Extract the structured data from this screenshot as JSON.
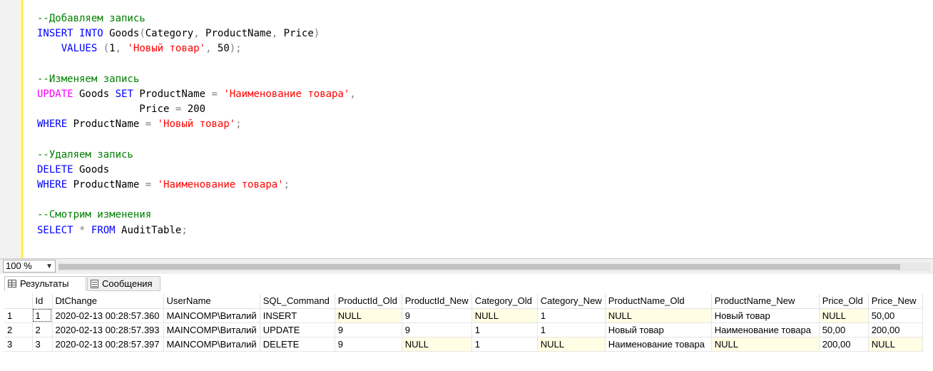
{
  "editor": {
    "lines": [
      [
        {
          "t": "--Добавляем запись",
          "c": "c"
        }
      ],
      [
        {
          "t": "INSERT",
          "c": "k"
        },
        {
          "t": " "
        },
        {
          "t": "INTO",
          "c": "k"
        },
        {
          "t": " Goods"
        },
        {
          "t": "(",
          "c": "g"
        },
        {
          "t": "Category"
        },
        {
          "t": ",",
          "c": "g"
        },
        {
          "t": " ProductName"
        },
        {
          "t": ",",
          "c": "g"
        },
        {
          "t": " Price"
        },
        {
          "t": ")",
          "c": "g"
        }
      ],
      [
        {
          "t": "    "
        },
        {
          "t": "VALUES",
          "c": "k"
        },
        {
          "t": " "
        },
        {
          "t": "(",
          "c": "g"
        },
        {
          "t": "1"
        },
        {
          "t": ",",
          "c": "g"
        },
        {
          "t": " "
        },
        {
          "t": "'Новый товар'",
          "c": "s"
        },
        {
          "t": ",",
          "c": "g"
        },
        {
          "t": " 50"
        },
        {
          "t": ");",
          "c": "g"
        }
      ],
      [],
      [
        {
          "t": "--Изменяем запись",
          "c": "c"
        }
      ],
      [
        {
          "t": "UPDATE",
          "c": "p"
        },
        {
          "t": " Goods "
        },
        {
          "t": "SET",
          "c": "k"
        },
        {
          "t": " ProductName "
        },
        {
          "t": "=",
          "c": "g"
        },
        {
          "t": " "
        },
        {
          "t": "'Наименование товара'",
          "c": "s"
        },
        {
          "t": ",",
          "c": "g"
        }
      ],
      [
        {
          "t": "                 Price "
        },
        {
          "t": "=",
          "c": "g"
        },
        {
          "t": " 200"
        }
      ],
      [
        {
          "t": "WHERE",
          "c": "k"
        },
        {
          "t": " ProductName "
        },
        {
          "t": "=",
          "c": "g"
        },
        {
          "t": " "
        },
        {
          "t": "'Новый товар'",
          "c": "s"
        },
        {
          "t": ";",
          "c": "g"
        }
      ],
      [],
      [
        {
          "t": "--Удаляем запись",
          "c": "c"
        }
      ],
      [
        {
          "t": "DELETE",
          "c": "k"
        },
        {
          "t": " Goods"
        }
      ],
      [
        {
          "t": "WHERE",
          "c": "k"
        },
        {
          "t": " ProductName "
        },
        {
          "t": "=",
          "c": "g"
        },
        {
          "t": " "
        },
        {
          "t": "'Наименование товара'",
          "c": "s"
        },
        {
          "t": ";",
          "c": "g"
        }
      ],
      [],
      [
        {
          "t": "--Смотрим изменения",
          "c": "c"
        }
      ],
      [
        {
          "t": "SELECT",
          "c": "k"
        },
        {
          "t": " "
        },
        {
          "t": "*",
          "c": "g"
        },
        {
          "t": " "
        },
        {
          "t": "FROM",
          "c": "k"
        },
        {
          "t": " AuditTable"
        },
        {
          "t": ";",
          "c": "g"
        }
      ]
    ]
  },
  "zoom": {
    "value": "100 %"
  },
  "tabs": {
    "results": "Результаты",
    "messages": "Сообщения"
  },
  "grid": {
    "columns": [
      "",
      "Id",
      "DtChange",
      "UserName",
      "SQL_Command",
      "ProductId_Old",
      "ProductId_New",
      "Category_Old",
      "Category_New",
      "ProductName_Old",
      "ProductName_New",
      "Price_Old",
      "Price_New"
    ],
    "rows": [
      [
        "1",
        "1",
        "2020-02-13 00:28:57.360",
        "MAINCOMP\\Виталий",
        "INSERT",
        "NULL",
        "9",
        "NULL",
        "1",
        "NULL",
        "Новый товар",
        "NULL",
        "50,00"
      ],
      [
        "2",
        "2",
        "2020-02-13 00:28:57.393",
        "MAINCOMP\\Виталий",
        "UPDATE",
        "9",
        "9",
        "1",
        "1",
        "Новый товар",
        "Наименование товара",
        "50,00",
        "200,00"
      ],
      [
        "3",
        "3",
        "2020-02-13 00:28:57.397",
        "MAINCOMP\\Виталий",
        "DELETE",
        "9",
        "NULL",
        "1",
        "NULL",
        "Наименование товара",
        "NULL",
        "200,00",
        "NULL"
      ]
    ]
  }
}
